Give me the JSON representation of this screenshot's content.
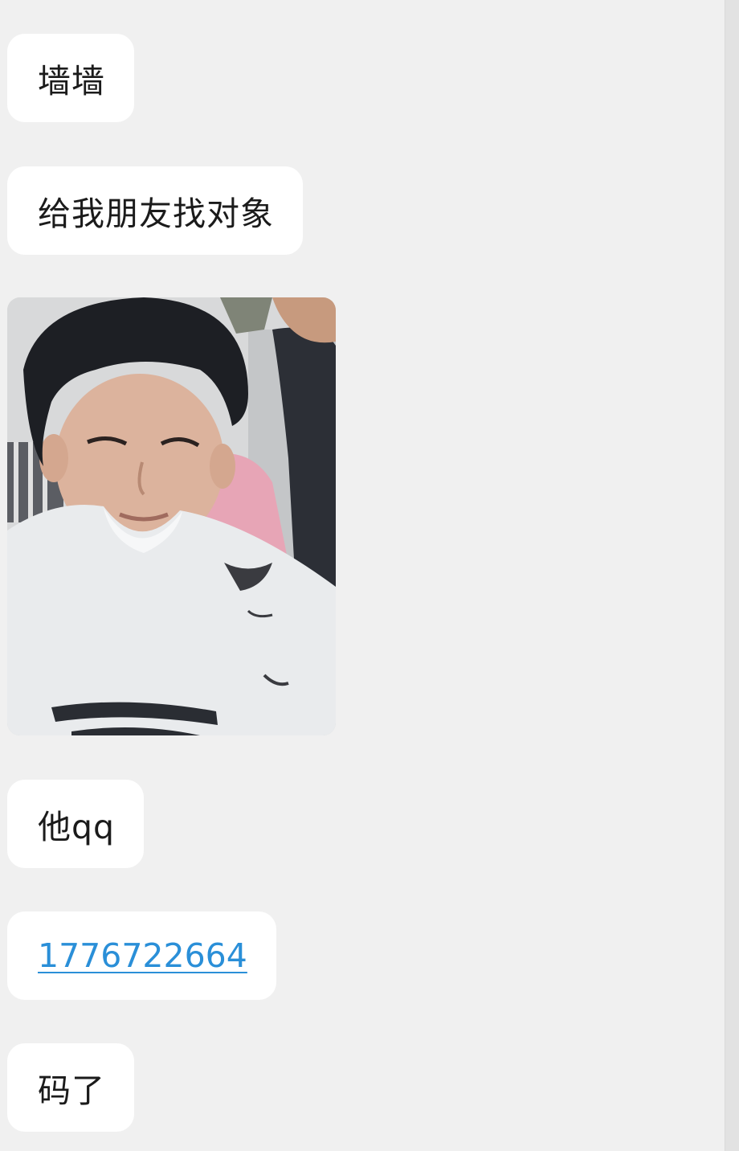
{
  "messages": [
    {
      "type": "text",
      "text": "墙墙"
    },
    {
      "type": "text",
      "text": "给我朋友找对象"
    },
    {
      "type": "image",
      "icon": "photo-of-boy-at-barber-icon"
    },
    {
      "type": "text",
      "text": "他qq"
    },
    {
      "type": "link",
      "text": "1776722664",
      "color": "#2a8fd8"
    },
    {
      "type": "text",
      "text": "码了"
    }
  ],
  "colors": {
    "background": "#f0f0f0",
    "bubble": "#ffffff",
    "link": "#2a8fd8"
  }
}
